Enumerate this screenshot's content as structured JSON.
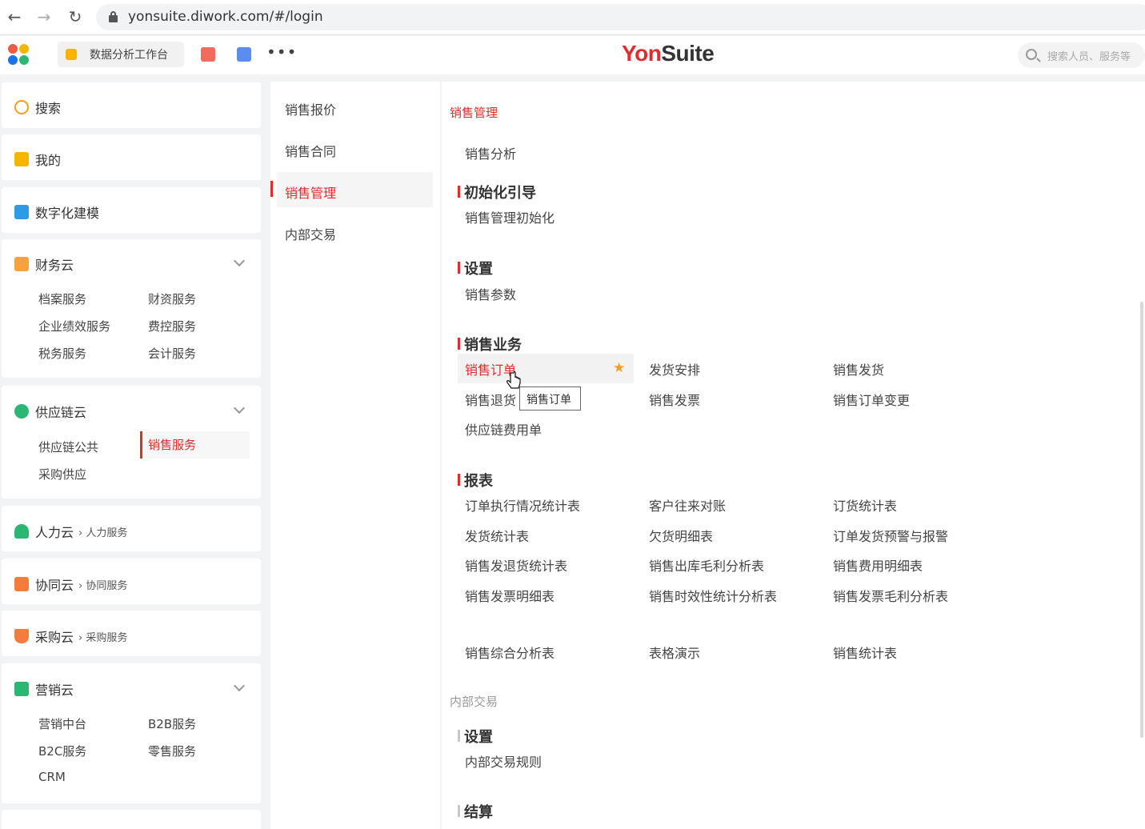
{
  "browser": {
    "url": "yonsuite.diwork.com/#/login",
    "back_icon": "←",
    "forward_icon": "→",
    "reload_icon": "↻"
  },
  "header": {
    "workspace_tab": "数据分析工作台",
    "more": "•••",
    "brand_yon": "Yon",
    "brand_suite": "Suite",
    "search_placeholder": "搜索人员、服务等"
  },
  "sidebar": {
    "search": "搜索",
    "mine": "我的",
    "digital_modeling": "数字化建模",
    "finance": {
      "title": "财务云",
      "items": [
        "档案服务",
        "财资服务",
        "企业绩效服务",
        "费控服务",
        "税务服务",
        "会计服务"
      ]
    },
    "supply": {
      "title": "供应链云",
      "items": [
        "供应链公共",
        "销售服务",
        "采购供应"
      ]
    },
    "hr": {
      "title": "人力云",
      "sub": "› 人力服务"
    },
    "collab": {
      "title": "协同云",
      "sub": "› 协同服务"
    },
    "purchase": {
      "title": "采购云",
      "sub": "› 采购服务"
    },
    "marketing": {
      "title": "营销云",
      "items": [
        "营销中台",
        "B2B服务",
        "B2C服务",
        "零售服务",
        "CRM"
      ]
    }
  },
  "middle": {
    "items": [
      "销售报价",
      "销售合同",
      "销售管理",
      "内部交易"
    ]
  },
  "content": {
    "group1": "销售管理",
    "analysis": "销售分析",
    "init": {
      "title": "初始化引导",
      "items": [
        "销售管理初始化"
      ]
    },
    "settings": {
      "title": "设置",
      "items": [
        "销售参数"
      ]
    },
    "business": {
      "title": "销售业务",
      "items": [
        "销售订单",
        "发货安排",
        "销售发货",
        "销售退货",
        "销售发票",
        "销售订单变更",
        "供应链费用单"
      ]
    },
    "tooltip": "销售订单",
    "reports": {
      "title": "报表",
      "items": [
        "订单执行情况统计表",
        "客户往来对账",
        "订货统计表",
        "发货统计表",
        "欠货明细表",
        "订单发货预警与报警",
        "销售发退货统计表",
        "销售出库毛利分析表",
        "销售费用明细表",
        "销售发票明细表",
        "销售时效性统计分析表",
        "销售发票毛利分析表",
        "销售综合分析表",
        "表格演示",
        "销售统计表"
      ]
    },
    "group2": "内部交易",
    "internal_settings": {
      "title": "设置",
      "items": [
        "内部交易规则"
      ]
    },
    "settlement": {
      "title": "结算"
    }
  },
  "colors": {
    "accent": "#e02c2c",
    "background": "#f2f3f5",
    "star": "#f0a020"
  }
}
